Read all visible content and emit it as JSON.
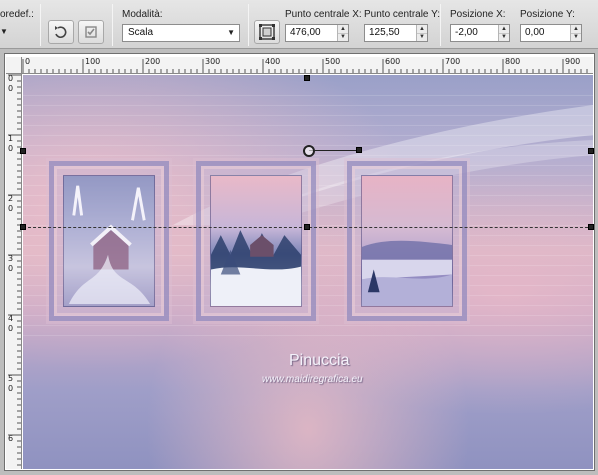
{
  "toolbar": {
    "preset_label": "oredef.:",
    "mode_label": "Modalità:",
    "mode_value": "Scala",
    "center_x_label": "Punto centrale X:",
    "center_x_value": "476,00",
    "center_y_label": "Punto centrale Y:",
    "center_y_value": "125,50",
    "pos_x_label": "Posizione X:",
    "pos_x_value": "-2,00",
    "pos_y_label": "Posizione Y:",
    "pos_y_value": "0,00",
    "icons": [
      "preset-dropdown-icon",
      "reset-icon",
      "apply-icon",
      "center-point-icon"
    ]
  },
  "ruler_top": [
    "0",
    "100",
    "200",
    "300",
    "400",
    "500",
    "600",
    "700",
    "800",
    "900"
  ],
  "ruler_left": [
    "0",
    "0",
    "1",
    "0",
    "2",
    "0",
    "3",
    "0",
    "4",
    "0",
    "5",
    "0",
    "6"
  ],
  "image": {
    "watermark_title": "Pinuccia",
    "watermark_url": "www.maidiregrafica.eu"
  }
}
